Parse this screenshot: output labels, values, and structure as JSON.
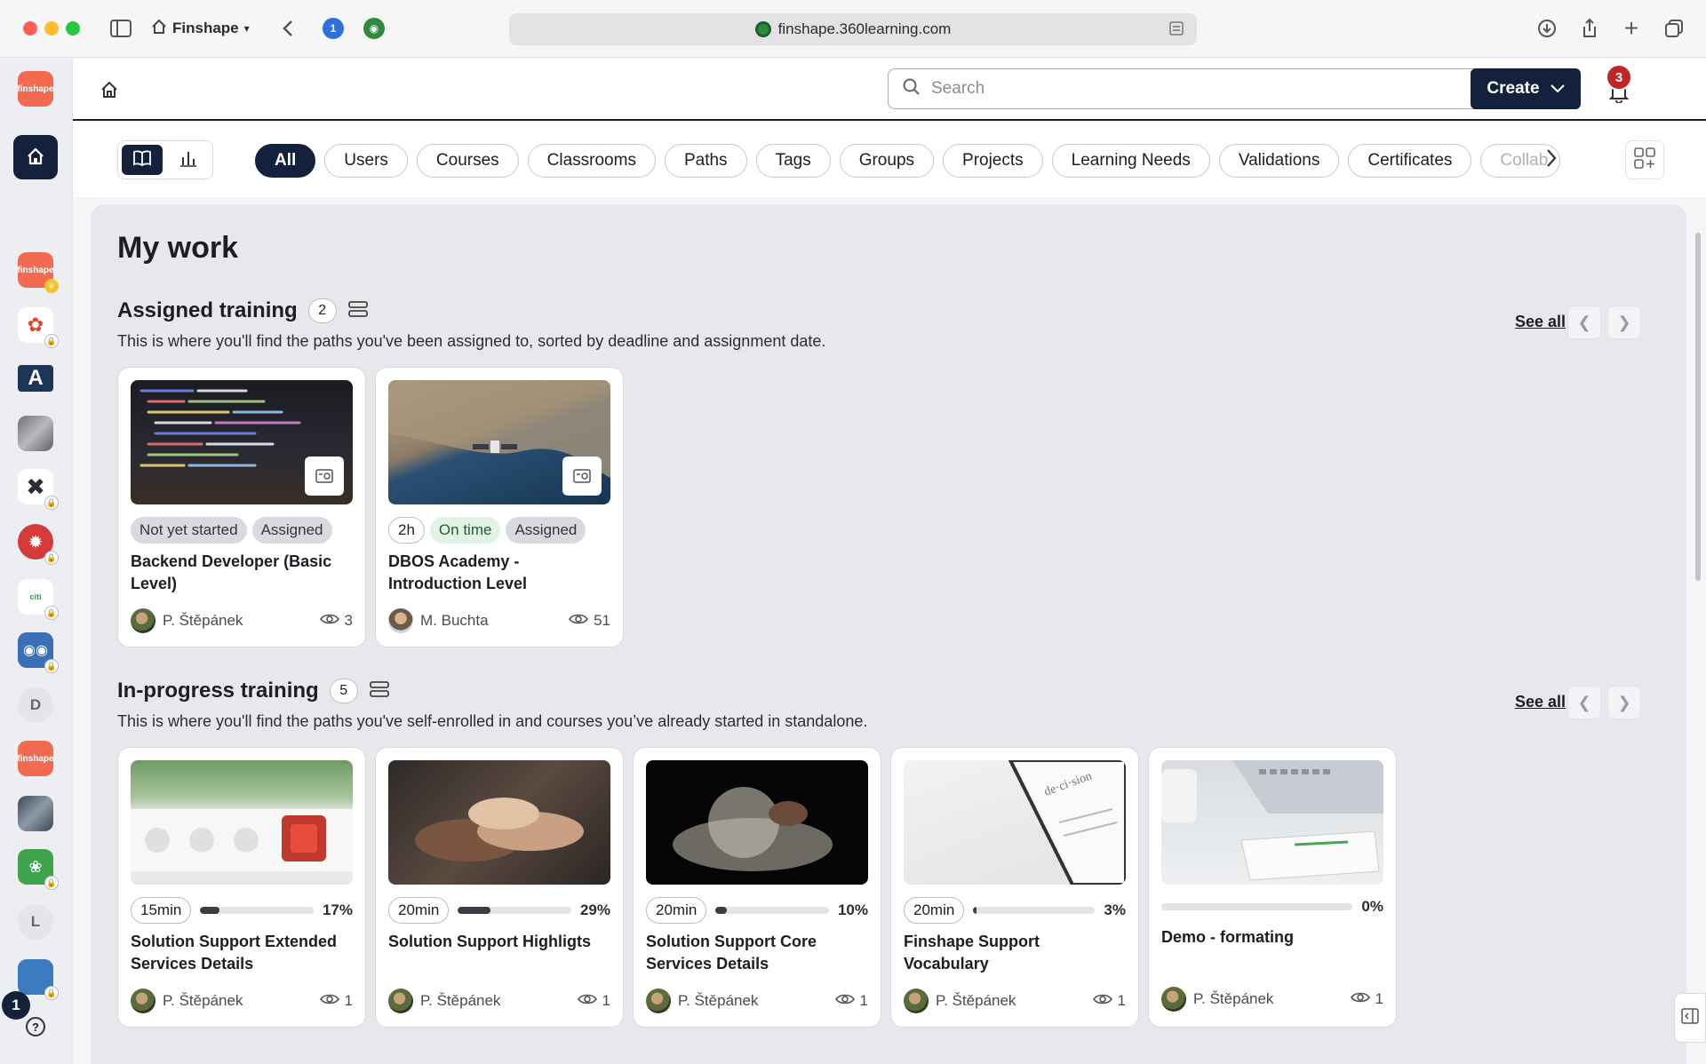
{
  "browser": {
    "tab_group_label": "Finshape",
    "url": "finshape.360learning.com"
  },
  "appbar": {
    "search_placeholder": "Search",
    "create_label": "Create",
    "notification_count": "3"
  },
  "filters": {
    "chips": [
      "All",
      "Users",
      "Courses",
      "Classrooms",
      "Paths",
      "Tags",
      "Groups",
      "Projects",
      "Learning Needs",
      "Validations",
      "Certificates",
      "Collab"
    ],
    "active": "All"
  },
  "rail": {
    "items": [
      {
        "label": "finshape",
        "color": "#f26a4f"
      },
      {
        "label": "finshape",
        "color": "#f26a4f"
      },
      {
        "label": "",
        "color": "#ffffff"
      },
      {
        "label": "A",
        "color": "#1d3557"
      },
      {
        "label": "",
        "color": "#8a8a8f"
      },
      {
        "label": "",
        "color": "#2c2c33"
      },
      {
        "label": "",
        "color": "#d63b3b"
      },
      {
        "label": "citi",
        "color": "#2e9c58"
      },
      {
        "label": "",
        "color": "#3b6fb6"
      },
      {
        "label": "D",
        "color": "#e4e5ea"
      },
      {
        "label": "finshape",
        "color": "#f26a4f"
      },
      {
        "label": "",
        "color": "#54606b"
      },
      {
        "label": "",
        "color": "#3fa34d"
      },
      {
        "label": "L",
        "color": "#e4e5ea"
      },
      {
        "label": "",
        "color": "#3b7bbf"
      }
    ],
    "bottom_badge": "1",
    "help": "?"
  },
  "main": {
    "title": "My work",
    "assigned": {
      "title": "Assigned training",
      "count": "2",
      "description": "This is where you'll find the paths you've been assigned to, sorted by deadline and assignment date.",
      "see_all": "See all",
      "cards": [
        {
          "tags": [
            {
              "text": "Not yet started",
              "style": "grey"
            },
            {
              "text": "Assigned",
              "style": "grey"
            }
          ],
          "title": "Backend Developer (Basic Level)",
          "author": "P. Štěpánek",
          "views": "3"
        },
        {
          "tags": [
            {
              "text": "2h",
              "style": "outline"
            },
            {
              "text": "On time",
              "style": "green"
            },
            {
              "text": "Assigned",
              "style": "grey"
            }
          ],
          "title": "DBOS Academy - Introduction Level",
          "author": "M. Buchta",
          "views": "51"
        }
      ]
    },
    "in_progress": {
      "title": "In-progress training",
      "count": "5",
      "description": "This is where you'll find the paths you've self-enrolled in and courses you’ve already started in standalone.",
      "see_all": "See all",
      "cards": [
        {
          "duration": "15min",
          "progress": 17,
          "progress_label": "17%",
          "title": "Solution Support Extended Services Details",
          "author": "P. Štěpánek",
          "views": "1"
        },
        {
          "duration": "20min",
          "progress": 29,
          "progress_label": "29%",
          "title": "Solution Support Highligts",
          "author": "P. Štěpánek",
          "views": "1"
        },
        {
          "duration": "20min",
          "progress": 10,
          "progress_label": "10%",
          "title": "Solution Support Core Services Details",
          "author": "P. Štěpánek",
          "views": "1"
        },
        {
          "duration": "20min",
          "progress": 3,
          "progress_label": "3%",
          "title": "Finshape Support Vocabulary",
          "author": "P. Štěpánek",
          "views": "1"
        },
        {
          "duration": "",
          "progress": 0,
          "progress_label": "0%",
          "title": "Demo - formating",
          "author": "P. Štěpánek",
          "views": "1"
        }
      ]
    }
  }
}
